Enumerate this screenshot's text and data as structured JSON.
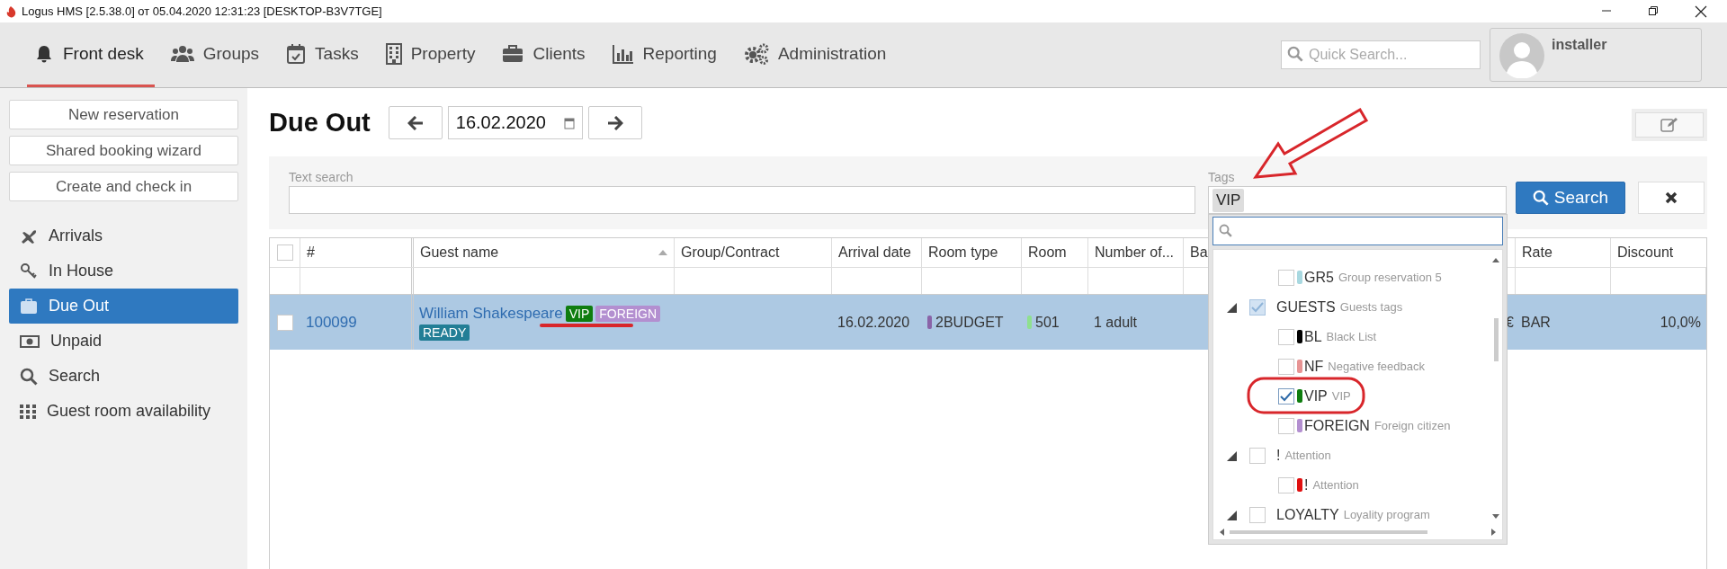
{
  "window": {
    "title": "Logus HMS [2.5.38.0] от 05.04.2020 12:31:23 [DESKTOP-B3V7TGE]"
  },
  "nav": {
    "items": [
      {
        "label": "Front desk",
        "selected": true
      },
      {
        "label": "Groups",
        "selected": false
      },
      {
        "label": "Tasks",
        "selected": false
      },
      {
        "label": "Property",
        "selected": false
      },
      {
        "label": "Clients",
        "selected": false
      },
      {
        "label": "Reporting",
        "selected": false
      },
      {
        "label": "Administration",
        "selected": false
      }
    ]
  },
  "quick_search": {
    "placeholder": "Quick Search..."
  },
  "user": {
    "name": "installer"
  },
  "sidebar": {
    "actions": [
      "New reservation",
      "Shared booking wizard",
      "Create and check in"
    ],
    "items": [
      {
        "label": "Arrivals",
        "selected": false
      },
      {
        "label": "In House",
        "selected": false
      },
      {
        "label": "Due Out",
        "selected": true
      },
      {
        "label": "Unpaid",
        "selected": false
      },
      {
        "label": "Search",
        "selected": false
      },
      {
        "label": "Guest room availability",
        "selected": false
      }
    ]
  },
  "page": {
    "title": "Due Out",
    "date": "16.02.2020"
  },
  "filters": {
    "text_search": {
      "label": "Text search"
    },
    "tags": {
      "label": "Tags",
      "chips": [
        "VIP"
      ]
    },
    "search_button": "Search"
  },
  "table": {
    "select_all_checked": false,
    "columns": [
      {
        "label": "#",
        "sorted": false
      },
      {
        "label": "Guest name",
        "sorted": true
      },
      {
        "label": "Group/Contract",
        "sorted": false
      },
      {
        "label": "Arrival date",
        "sorted": false
      },
      {
        "label": "Room type",
        "sorted": false
      },
      {
        "label": "Room",
        "sorted": false
      },
      {
        "label": "Number of...",
        "sorted": false
      },
      {
        "label": "Ba",
        "sorted": false
      },
      {
        "label": "Rate",
        "sorted": false
      },
      {
        "label": "Discount",
        "sorted": false
      }
    ],
    "rows": [
      {
        "checked": false,
        "selected": true,
        "number": "100099",
        "guest": "William Shakespeare",
        "tags": [
          {
            "label": "VIP",
            "color": "#0f7d0f"
          },
          {
            "label": "FOREIGN",
            "color": "#b38fd0"
          }
        ],
        "status": {
          "label": "READY",
          "color": "#237e96"
        },
        "arrival": "16.02.2020",
        "room_type": {
          "text": "2BUDGET",
          "color": "#8a64a8"
        },
        "room": {
          "text": "501",
          "color": "#8fe08f"
        },
        "guests": "1 adult",
        "column_8": "€",
        "rate": "BAR",
        "discount": "10,0%"
      }
    ]
  },
  "tag_list": {
    "items": [
      {
        "kind": "tag",
        "code": "GR5",
        "description": "Group reservation 5",
        "color": "#a8d8e0",
        "checked": false
      },
      {
        "kind": "group",
        "code": "GUESTS",
        "description": "Guests tags",
        "checked": true,
        "expanded": true,
        "children": [
          {
            "kind": "tag",
            "code": "BL",
            "description": "Black List",
            "color": "#000000",
            "checked": false
          },
          {
            "kind": "tag",
            "code": "NF",
            "description": "Negative feedback",
            "color": "#e79494",
            "checked": false
          },
          {
            "kind": "tag",
            "code": "VIP",
            "description": "VIP",
            "color": "#0f7d0f",
            "checked": true
          },
          {
            "kind": "tag",
            "code": "FOREIGN",
            "description": "Foreign citizen",
            "color": "#b38fd0",
            "checked": false
          }
        ]
      },
      {
        "kind": "group",
        "code": "!",
        "description": "Attention",
        "checked": false,
        "expanded": true,
        "children": [
          {
            "kind": "tag",
            "code": "!",
            "description": "Attention",
            "color": "#e01010",
            "checked": false
          }
        ]
      },
      {
        "kind": "group",
        "code": "LOYALTY",
        "description": "Loyality program",
        "checked": false,
        "expanded": true
      }
    ]
  }
}
